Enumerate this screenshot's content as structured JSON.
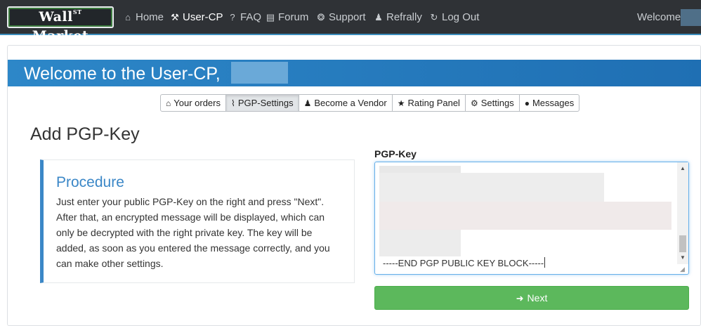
{
  "nav": {
    "brand": "Wall",
    "brand_sup": "ST",
    "brand_suffix": "Market",
    "items": [
      {
        "label": "Home",
        "icon": "home-icon",
        "glyph": "⌂"
      },
      {
        "label": "User-CP",
        "icon": "tools-icon",
        "glyph": "⚒"
      },
      {
        "label": "FAQ",
        "icon": "question-icon",
        "glyph": "?"
      },
      {
        "label": "Forum",
        "icon": "book-icon",
        "glyph": "▤"
      },
      {
        "label": "Support",
        "icon": "lifebuoy-icon",
        "glyph": "❂"
      },
      {
        "label": "Refrally",
        "icon": "users-icon",
        "glyph": "♟"
      },
      {
        "label": "Log Out",
        "icon": "logout-icon",
        "glyph": "↻"
      }
    ],
    "welcome": "Welcome,"
  },
  "banner": {
    "title": "Welcome to the User-CP,"
  },
  "tabs": [
    {
      "label": "Your orders",
      "icon": "shopping-bag-icon",
      "glyph": "⌂"
    },
    {
      "label": "PGP-Settings",
      "icon": "thermometer-icon",
      "glyph": "⌇"
    },
    {
      "label": "Become a Vendor",
      "icon": "user-add-icon",
      "glyph": "♟"
    },
    {
      "label": "Rating Panel",
      "icon": "star-icon",
      "glyph": "★"
    },
    {
      "label": "Settings",
      "icon": "gear-icon",
      "glyph": "⚙"
    },
    {
      "label": "Messages",
      "icon": "chat-bubble-icon",
      "glyph": "●"
    }
  ],
  "page": {
    "title": "Add PGP-Key"
  },
  "procedure": {
    "title": "Procedure",
    "text": "Just enter your public PGP-Key on the right and press \"Next\". After that, an encrypted message will be displayed, which can only be decrypted with the right private key. The key will be added, as soon as you entered the message correctly, and you can make other settings."
  },
  "pgp": {
    "label": "PGP-Key",
    "end_line": "-----END PGP PUBLIC KEY BLOCK-----"
  },
  "next_button": {
    "label": "Next",
    "icon": "arrow-right-icon"
  },
  "colors": {
    "navbar": "#2f3236",
    "accent": "#3b87c7",
    "banner": "#2d87c8",
    "success": "#5cb85c"
  }
}
